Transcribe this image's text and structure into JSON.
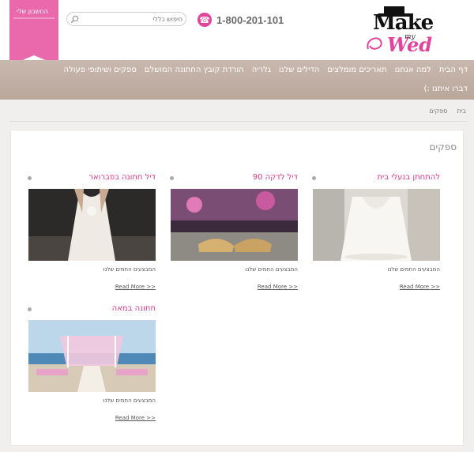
{
  "header": {
    "logo": {
      "word1": "Make",
      "word2": "my",
      "word3": "Wed"
    },
    "phone": "1-800-201-101",
    "search": {
      "placeholder": "חיפוש כללי"
    },
    "account": "החשבון שלי"
  },
  "nav": {
    "items": [
      "דף הבית",
      "למה אנחנו",
      "תאריכים מומלצים",
      "הדילים שלנו",
      "גלריה",
      "הורדת קובץ החתונה המושלם",
      "ספקים ושיתופי פעולה"
    ],
    "item_last": "דברו איתנו :)"
  },
  "breadcrumbs": [
    "בית",
    "ספקים"
  ],
  "page": {
    "title": "ספקים"
  },
  "cards": [
    {
      "title": "להתחתן בנעלי בית",
      "caption": "המבצעים החמים שלנו",
      "more": "Read More >>"
    },
    {
      "title": "דיל לדקה 90",
      "caption": "המבצעים החמים שלנו",
      "more": "Read More >>"
    },
    {
      "title": "דיל חתונה בפברואר",
      "caption": "המבצעים החמים שלנו",
      "more": "Read More >>"
    },
    {
      "title": "חתונה במאה",
      "caption": "המבצעים החמים שלנו",
      "more": "Read More >>"
    }
  ],
  "colors": {
    "accent": "#e0459b",
    "nav": "#bdaba1",
    "page_bg": "#f0efee"
  }
}
